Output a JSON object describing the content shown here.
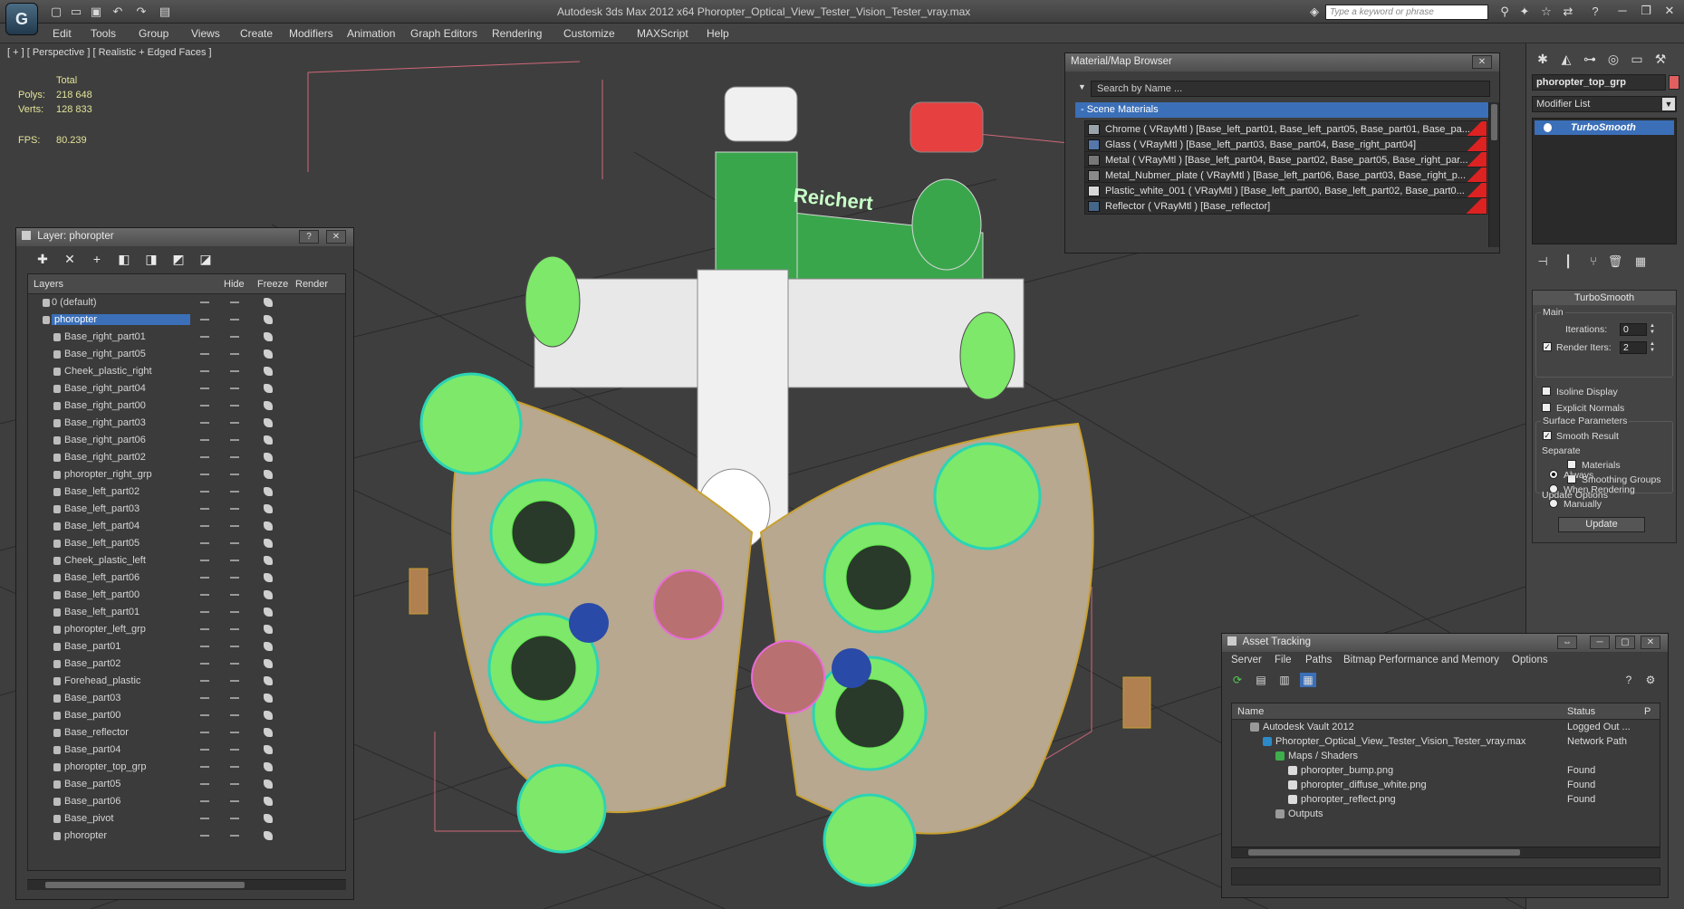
{
  "app": {
    "title": "Autodesk 3ds Max  2012 x64     Phoropter_Optical_View_Tester_Vision_Tester_vray.max",
    "logo": "3ds-max-logo",
    "search_placeholder": "Type a keyword or phrase"
  },
  "menu": [
    "Edit",
    "Tools",
    "Group",
    "Views",
    "Create",
    "Modifiers",
    "Animation",
    "Graph Editors",
    "Rendering",
    "Customize",
    "MAXScript",
    "Help"
  ],
  "viewport": {
    "label": "[ + ] [ Perspective ] [ Realistic + Edged Faces ]",
    "stats": {
      "total_label": "Total",
      "polys_label": "Polys:",
      "polys_value": "218 648",
      "verts_label": "Verts:",
      "verts_value": "128 833",
      "fps_label": "FPS:",
      "fps_value": "80.239"
    },
    "model_logo_text": "Reichert"
  },
  "layer_panel": {
    "title": "Layer: phoropter",
    "columns": [
      "Layers",
      "Hide",
      "Freeze",
      "Render"
    ],
    "rows": [
      {
        "name": "0 (default)",
        "level": 1
      },
      {
        "name": "phoropter",
        "level": 1,
        "selected": true
      },
      {
        "name": "Base_right_part01",
        "level": 2
      },
      {
        "name": "Base_right_part05",
        "level": 2
      },
      {
        "name": "Cheek_plastic_right",
        "level": 2
      },
      {
        "name": "Base_right_part04",
        "level": 2
      },
      {
        "name": "Base_right_part00",
        "level": 2
      },
      {
        "name": "Base_right_part03",
        "level": 2
      },
      {
        "name": "Base_right_part06",
        "level": 2
      },
      {
        "name": "Base_right_part02",
        "level": 2
      },
      {
        "name": "phoropter_right_grp",
        "level": 2
      },
      {
        "name": "Base_left_part02",
        "level": 2
      },
      {
        "name": "Base_left_part03",
        "level": 2
      },
      {
        "name": "Base_left_part04",
        "level": 2
      },
      {
        "name": "Base_left_part05",
        "level": 2
      },
      {
        "name": "Cheek_plastic_left",
        "level": 2
      },
      {
        "name": "Base_left_part06",
        "level": 2
      },
      {
        "name": "Base_left_part00",
        "level": 2
      },
      {
        "name": "Base_left_part01",
        "level": 2
      },
      {
        "name": "phoropter_left_grp",
        "level": 2
      },
      {
        "name": "Base_part01",
        "level": 2
      },
      {
        "name": "Base_part02",
        "level": 2
      },
      {
        "name": "Forehead_plastic",
        "level": 2
      },
      {
        "name": "Base_part03",
        "level": 2
      },
      {
        "name": "Base_part00",
        "level": 2
      },
      {
        "name": "Base_reflector",
        "level": 2
      },
      {
        "name": "Base_part04",
        "level": 2
      },
      {
        "name": "phoropter_top_grp",
        "level": 2
      },
      {
        "name": "Base_part05",
        "level": 2
      },
      {
        "name": "Base_part06",
        "level": 2
      },
      {
        "name": "Base_pivot",
        "level": 2
      },
      {
        "name": "phoropter",
        "level": 2
      }
    ]
  },
  "material_browser": {
    "title": "Material/Map Browser",
    "search_placeholder": "Search by Name ...",
    "section": "- Scene Materials",
    "materials": [
      {
        "label": "Chrome  ( VRayMtl ) [Base_left_part01, Base_left_part05, Base_part01, Base_pa...",
        "swatch": "#9aa2aa"
      },
      {
        "label": "Glass  ( VRayMtl ) [Base_left_part03, Base_part04, Base_right_part04]",
        "swatch": "#5577aa"
      },
      {
        "label": "Metal  ( VRayMtl ) [Base_left_part04, Base_part02, Base_part05, Base_right_par...",
        "swatch": "#777777"
      },
      {
        "label": "Metal_Nubmer_plate  ( VRayMtl ) [Base_left_part06, Base_part03, Base_right_p...",
        "swatch": "#8a8a8a"
      },
      {
        "label": "Plastic_white_001  ( VRayMtl ) [Base_left_part00, Base_left_part02, Base_part0...",
        "swatch": "#d8d8d8"
      },
      {
        "label": "Reflector  ( VRayMtl ) [Base_reflector]",
        "swatch": "#446688"
      }
    ]
  },
  "command_panel": {
    "object_name": "phoropter_top_grp",
    "object_color": "#e06060",
    "modifier_list": "Modifier List",
    "stack_item": "TurboSmooth",
    "rollout_title": "TurboSmooth",
    "main_group": "Main",
    "iterations_label": "Iterations:",
    "iterations_value": "0",
    "render_iters_label": "Render Iters:",
    "render_iters_value": "2",
    "isoline_label": "Isoline Display",
    "explicit_normals_label": "Explicit Normals",
    "surface_group": "Surface Parameters",
    "smooth_result_label": "Smooth Result",
    "separate_label": "Separate",
    "materials_label": "Materials",
    "smoothing_groups_label": "Smoothing Groups",
    "update_group": "Update Options",
    "always_label": "Always",
    "when_rendering_label": "When Rendering",
    "manually_label": "Manually",
    "update_button": "Update"
  },
  "asset_tracking": {
    "title": "Asset Tracking",
    "menu": [
      "Server",
      "File",
      "Paths",
      "Bitmap Performance and Memory",
      "Options"
    ],
    "columns": [
      "Name",
      "Status",
      "P"
    ],
    "rows": [
      {
        "name": "Autodesk Vault 2012",
        "status": "Logged Out ...",
        "level": 0,
        "icon_color": "#9a9a9a"
      },
      {
        "name": "Phoropter_Optical_View_Tester_Vision_Tester_vray.max",
        "status": "Network Path",
        "level": 1,
        "icon_color": "#2c8ac8"
      },
      {
        "name": "Maps / Shaders",
        "status": "",
        "level": 2,
        "icon_color": "#3fae4c"
      },
      {
        "name": "phoropter_bump.png",
        "status": "Found",
        "level": 3,
        "icon_color": "#dcdcdc"
      },
      {
        "name": "phoropter_diffuse_white.png",
        "status": "Found",
        "level": 3,
        "icon_color": "#dcdcdc"
      },
      {
        "name": "phoropter_reflect.png",
        "status": "Found",
        "level": 3,
        "icon_color": "#dcdcdc"
      },
      {
        "name": "Outputs",
        "status": "",
        "level": 2,
        "icon_color": "#9a9a9a"
      }
    ]
  }
}
